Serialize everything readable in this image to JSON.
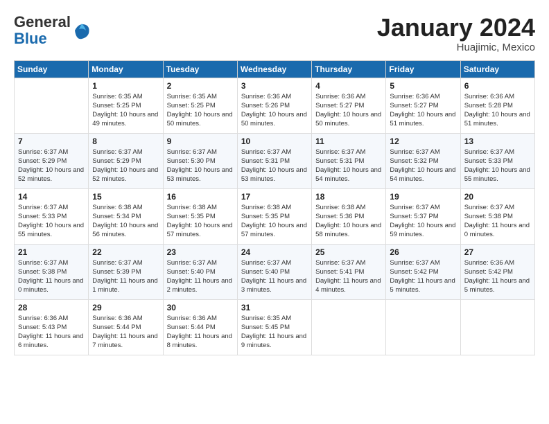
{
  "header": {
    "logo_general": "General",
    "logo_blue": "Blue",
    "month_title": "January 2024",
    "location": "Huajimic, Mexico"
  },
  "days_of_week": [
    "Sunday",
    "Monday",
    "Tuesday",
    "Wednesday",
    "Thursday",
    "Friday",
    "Saturday"
  ],
  "weeks": [
    [
      {
        "day": "",
        "sunrise": "",
        "sunset": "",
        "daylight": ""
      },
      {
        "day": "1",
        "sunrise": "Sunrise: 6:35 AM",
        "sunset": "Sunset: 5:25 PM",
        "daylight": "Daylight: 10 hours and 49 minutes."
      },
      {
        "day": "2",
        "sunrise": "Sunrise: 6:35 AM",
        "sunset": "Sunset: 5:25 PM",
        "daylight": "Daylight: 10 hours and 50 minutes."
      },
      {
        "day": "3",
        "sunrise": "Sunrise: 6:36 AM",
        "sunset": "Sunset: 5:26 PM",
        "daylight": "Daylight: 10 hours and 50 minutes."
      },
      {
        "day": "4",
        "sunrise": "Sunrise: 6:36 AM",
        "sunset": "Sunset: 5:27 PM",
        "daylight": "Daylight: 10 hours and 50 minutes."
      },
      {
        "day": "5",
        "sunrise": "Sunrise: 6:36 AM",
        "sunset": "Sunset: 5:27 PM",
        "daylight": "Daylight: 10 hours and 51 minutes."
      },
      {
        "day": "6",
        "sunrise": "Sunrise: 6:36 AM",
        "sunset": "Sunset: 5:28 PM",
        "daylight": "Daylight: 10 hours and 51 minutes."
      }
    ],
    [
      {
        "day": "7",
        "sunrise": "Sunrise: 6:37 AM",
        "sunset": "Sunset: 5:29 PM",
        "daylight": "Daylight: 10 hours and 52 minutes."
      },
      {
        "day": "8",
        "sunrise": "Sunrise: 6:37 AM",
        "sunset": "Sunset: 5:29 PM",
        "daylight": "Daylight: 10 hours and 52 minutes."
      },
      {
        "day": "9",
        "sunrise": "Sunrise: 6:37 AM",
        "sunset": "Sunset: 5:30 PM",
        "daylight": "Daylight: 10 hours and 53 minutes."
      },
      {
        "day": "10",
        "sunrise": "Sunrise: 6:37 AM",
        "sunset": "Sunset: 5:31 PM",
        "daylight": "Daylight: 10 hours and 53 minutes."
      },
      {
        "day": "11",
        "sunrise": "Sunrise: 6:37 AM",
        "sunset": "Sunset: 5:31 PM",
        "daylight": "Daylight: 10 hours and 54 minutes."
      },
      {
        "day": "12",
        "sunrise": "Sunrise: 6:37 AM",
        "sunset": "Sunset: 5:32 PM",
        "daylight": "Daylight: 10 hours and 54 minutes."
      },
      {
        "day": "13",
        "sunrise": "Sunrise: 6:37 AM",
        "sunset": "Sunset: 5:33 PM",
        "daylight": "Daylight: 10 hours and 55 minutes."
      }
    ],
    [
      {
        "day": "14",
        "sunrise": "Sunrise: 6:37 AM",
        "sunset": "Sunset: 5:33 PM",
        "daylight": "Daylight: 10 hours and 55 minutes."
      },
      {
        "day": "15",
        "sunrise": "Sunrise: 6:38 AM",
        "sunset": "Sunset: 5:34 PM",
        "daylight": "Daylight: 10 hours and 56 minutes."
      },
      {
        "day": "16",
        "sunrise": "Sunrise: 6:38 AM",
        "sunset": "Sunset: 5:35 PM",
        "daylight": "Daylight: 10 hours and 57 minutes."
      },
      {
        "day": "17",
        "sunrise": "Sunrise: 6:38 AM",
        "sunset": "Sunset: 5:35 PM",
        "daylight": "Daylight: 10 hours and 57 minutes."
      },
      {
        "day": "18",
        "sunrise": "Sunrise: 6:38 AM",
        "sunset": "Sunset: 5:36 PM",
        "daylight": "Daylight: 10 hours and 58 minutes."
      },
      {
        "day": "19",
        "sunrise": "Sunrise: 6:37 AM",
        "sunset": "Sunset: 5:37 PM",
        "daylight": "Daylight: 10 hours and 59 minutes."
      },
      {
        "day": "20",
        "sunrise": "Sunrise: 6:37 AM",
        "sunset": "Sunset: 5:38 PM",
        "daylight": "Daylight: 11 hours and 0 minutes."
      }
    ],
    [
      {
        "day": "21",
        "sunrise": "Sunrise: 6:37 AM",
        "sunset": "Sunset: 5:38 PM",
        "daylight": "Daylight: 11 hours and 0 minutes."
      },
      {
        "day": "22",
        "sunrise": "Sunrise: 6:37 AM",
        "sunset": "Sunset: 5:39 PM",
        "daylight": "Daylight: 11 hours and 1 minute."
      },
      {
        "day": "23",
        "sunrise": "Sunrise: 6:37 AM",
        "sunset": "Sunset: 5:40 PM",
        "daylight": "Daylight: 11 hours and 2 minutes."
      },
      {
        "day": "24",
        "sunrise": "Sunrise: 6:37 AM",
        "sunset": "Sunset: 5:40 PM",
        "daylight": "Daylight: 11 hours and 3 minutes."
      },
      {
        "day": "25",
        "sunrise": "Sunrise: 6:37 AM",
        "sunset": "Sunset: 5:41 PM",
        "daylight": "Daylight: 11 hours and 4 minutes."
      },
      {
        "day": "26",
        "sunrise": "Sunrise: 6:37 AM",
        "sunset": "Sunset: 5:42 PM",
        "daylight": "Daylight: 11 hours and 5 minutes."
      },
      {
        "day": "27",
        "sunrise": "Sunrise: 6:36 AM",
        "sunset": "Sunset: 5:42 PM",
        "daylight": "Daylight: 11 hours and 5 minutes."
      }
    ],
    [
      {
        "day": "28",
        "sunrise": "Sunrise: 6:36 AM",
        "sunset": "Sunset: 5:43 PM",
        "daylight": "Daylight: 11 hours and 6 minutes."
      },
      {
        "day": "29",
        "sunrise": "Sunrise: 6:36 AM",
        "sunset": "Sunset: 5:44 PM",
        "daylight": "Daylight: 11 hours and 7 minutes."
      },
      {
        "day": "30",
        "sunrise": "Sunrise: 6:36 AM",
        "sunset": "Sunset: 5:44 PM",
        "daylight": "Daylight: 11 hours and 8 minutes."
      },
      {
        "day": "31",
        "sunrise": "Sunrise: 6:35 AM",
        "sunset": "Sunset: 5:45 PM",
        "daylight": "Daylight: 11 hours and 9 minutes."
      },
      {
        "day": "",
        "sunrise": "",
        "sunset": "",
        "daylight": ""
      },
      {
        "day": "",
        "sunrise": "",
        "sunset": "",
        "daylight": ""
      },
      {
        "day": "",
        "sunrise": "",
        "sunset": "",
        "daylight": ""
      }
    ]
  ]
}
